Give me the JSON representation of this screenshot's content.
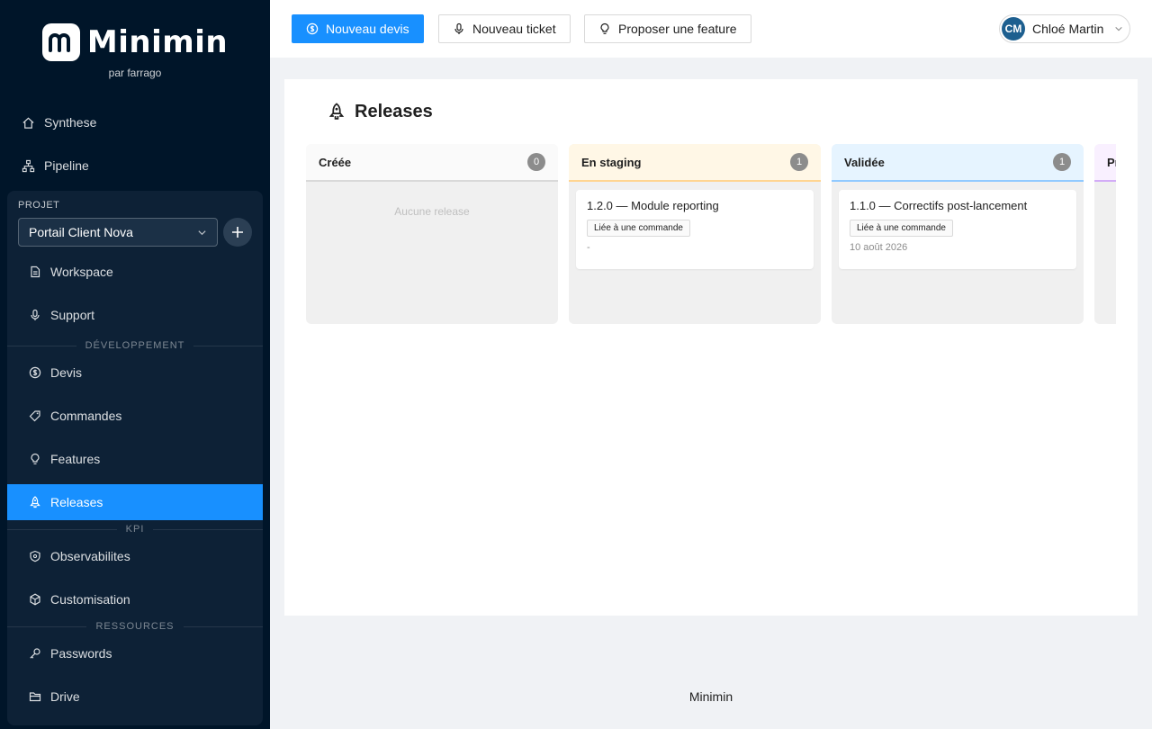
{
  "brand": {
    "name": "Minimin",
    "subtitle": "par farrago"
  },
  "sidebar": {
    "top_items": [
      {
        "label": "Synthese",
        "icon": "home-icon"
      },
      {
        "label": "Pipeline",
        "icon": "sitemap-icon"
      }
    ],
    "project_label": "PROJET",
    "project_selected": "Portail Client Nova",
    "sections": {
      "dev": "DÉVELOPPEMENT",
      "kpi": "KPI",
      "resources": "RESSOURCES"
    },
    "items": [
      {
        "label": "Workspace",
        "icon": "file-icon"
      },
      {
        "label": "Support",
        "icon": "microphone-icon"
      },
      {
        "label": "Devis",
        "icon": "dollar-icon"
      },
      {
        "label": "Commandes",
        "icon": "tag-icon"
      },
      {
        "label": "Features",
        "icon": "bulb-icon"
      },
      {
        "label": "Releases",
        "icon": "rocket-icon",
        "active": true
      },
      {
        "label": "Observabilites",
        "icon": "eye-icon"
      },
      {
        "label": "Customisation",
        "icon": "settings-icon"
      },
      {
        "label": "Passwords",
        "icon": "key-icon"
      },
      {
        "label": "Drive",
        "icon": "folder-icon"
      }
    ]
  },
  "header": {
    "new_quote": "Nouveau devis",
    "new_ticket": "Nouveau ticket",
    "propose_feature": "Proposer une feature",
    "user": {
      "initials": "CM",
      "name": "Chloé Martin"
    }
  },
  "page": {
    "title": "Releases"
  },
  "board": {
    "columns": [
      {
        "title": "Créée",
        "count": "0",
        "empty_text": "Aucune release"
      },
      {
        "title": "En staging",
        "count": "1",
        "cards": [
          {
            "title": "1.2.0 — Module reporting",
            "tag": "Liée à une commande",
            "date": "-"
          }
        ]
      },
      {
        "title": "Validée",
        "count": "1",
        "cards": [
          {
            "title": "1.1.0 — Correctifs post-lancement",
            "tag": "Liée à une commande",
            "date": "10 août 2026"
          }
        ]
      },
      {
        "title": "Pr"
      }
    ]
  },
  "footer": {
    "text": "Minimin"
  },
  "colors": {
    "primary": "#1890ff",
    "sidebar": "#001529"
  }
}
